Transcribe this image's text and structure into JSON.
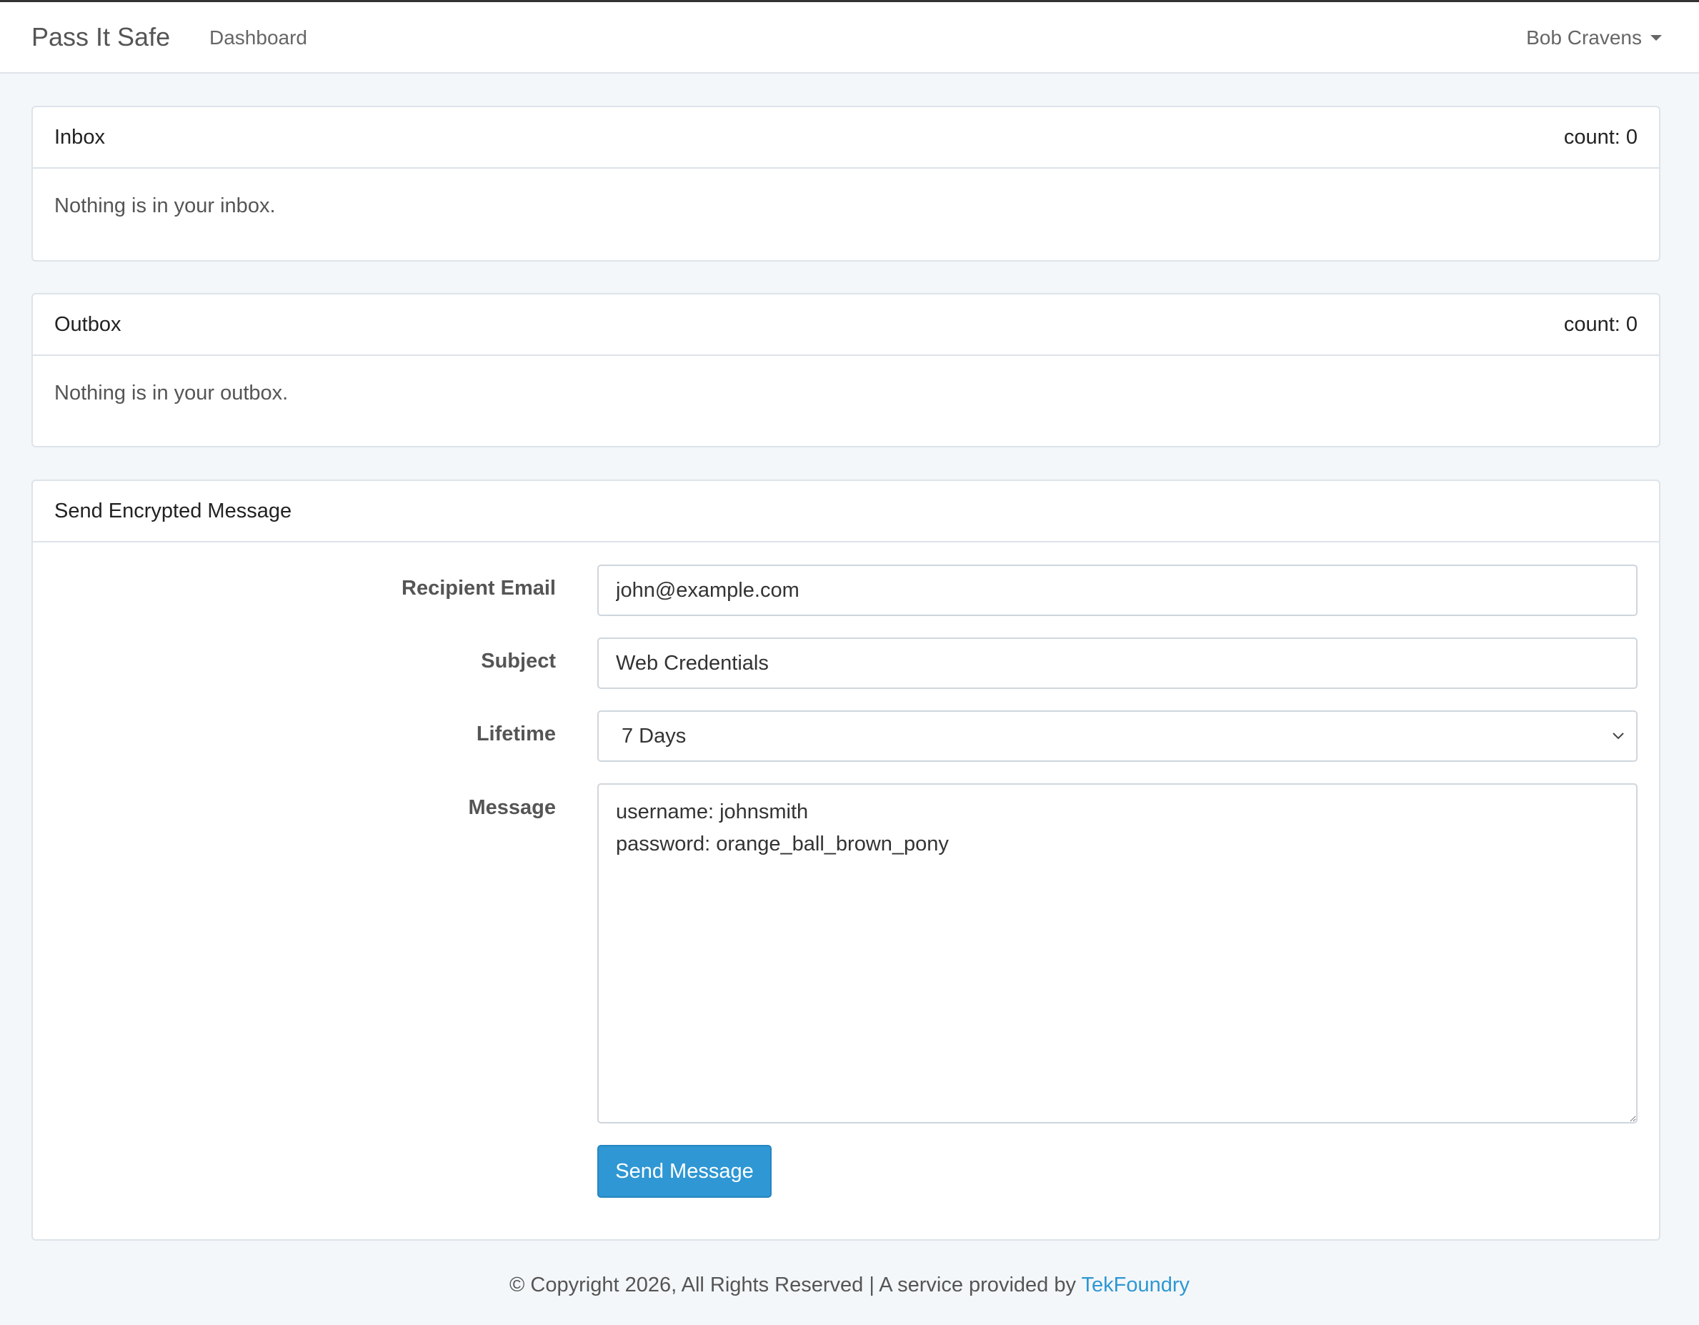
{
  "navbar": {
    "brand": "Pass It Safe",
    "dashboard_link": "Dashboard",
    "user_name": "Bob Cravens",
    "user_icon": "caret-down-icon"
  },
  "inbox": {
    "title": "Inbox",
    "count_label": "count: 0",
    "empty_text": "Nothing is in your inbox."
  },
  "outbox": {
    "title": "Outbox",
    "count_label": "count: 0",
    "empty_text": "Nothing is in your outbox."
  },
  "compose": {
    "title": "Send Encrypted Message",
    "recipient_label": "Recipient Email",
    "recipient_value": "john@example.com",
    "subject_label": "Subject",
    "subject_value": "Web Credentials",
    "lifetime_label": "Lifetime",
    "lifetime_value": "7 Days",
    "message_label": "Message",
    "message_value": "username: johnsmith\npassword: orange_ball_brown_pony",
    "send_label": "Send Message"
  },
  "footer": {
    "text": "© Copyright 2026, All Rights Reserved | A service provided by ",
    "link_text": "TekFoundry"
  },
  "colors": {
    "accent": "#2e97d4",
    "background": "#f4f7f9"
  }
}
